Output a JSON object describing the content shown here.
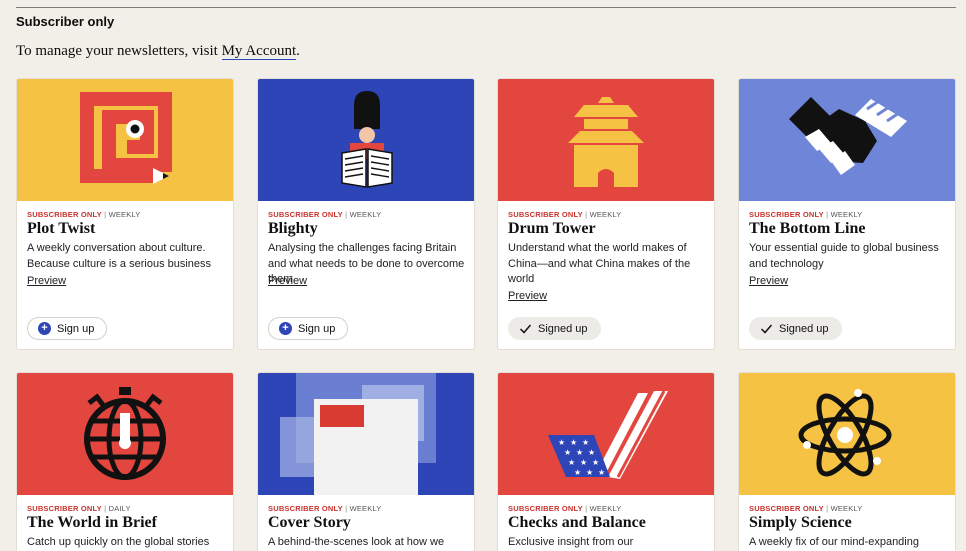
{
  "header": {
    "title": "Subscriber only",
    "manage_prefix": "To manage your newsletters, visit ",
    "manage_link": "My Account",
    "manage_suffix": "."
  },
  "colors": {
    "yellow": "#f5c244",
    "blue": "#2e45b8",
    "red": "#e3463f",
    "lavender": "#6f85d8",
    "tag_red": "#c7332d"
  },
  "cards": [
    {
      "tag": "SUBSCRIBER ONLY",
      "frequency": "WEEKLY",
      "title": "Plot Twist",
      "description": "A weekly conversation about culture. Because culture is a serious business",
      "preview": "Preview",
      "action": "Sign up",
      "icon": "spiral-pencil-icon"
    },
    {
      "tag": "SUBSCRIBER ONLY",
      "frequency": "WEEKLY",
      "title": "Blighty",
      "description": "Analysing the challenges facing Britain and what needs to be done to overcome them",
      "preview": "Preview",
      "action": "Sign up",
      "icon": "guardsman-newspaper-icon"
    },
    {
      "tag": "SUBSCRIBER ONLY",
      "frequency": "WEEKLY",
      "title": "Drum Tower",
      "description": "Understand what the world makes of China—and what China makes of the world",
      "preview": "Preview",
      "action": "Signed up",
      "icon": "pagoda-icon"
    },
    {
      "tag": "SUBSCRIBER ONLY",
      "frequency": "WEEKLY",
      "title": "The Bottom Line",
      "description": "Your essential guide to global business and technology",
      "preview": "Preview",
      "action": "Signed up",
      "icon": "handshake-icon"
    },
    {
      "tag": "SUBSCRIBER ONLY",
      "frequency": "DAILY",
      "title": "The World in Brief",
      "description": "Catch up quickly on the global stories that",
      "icon": "globe-stopwatch-icon"
    },
    {
      "tag": "SUBSCRIBER ONLY",
      "frequency": "WEEKLY",
      "title": "Cover Story",
      "description": "A behind-the-scenes look at how we chose",
      "icon": "cover-pages-icon"
    },
    {
      "tag": "SUBSCRIBER ONLY",
      "frequency": "WEEKLY",
      "title": "Checks and Balance",
      "description": "Exclusive insight from our correspondents",
      "icon": "flag-checkmark-icon"
    },
    {
      "tag": "SUBSCRIBER ONLY",
      "frequency": "WEEKLY",
      "title": "Simply Science",
      "description": "A weekly fix of our mind-expanding",
      "icon": "atom-icon"
    }
  ]
}
